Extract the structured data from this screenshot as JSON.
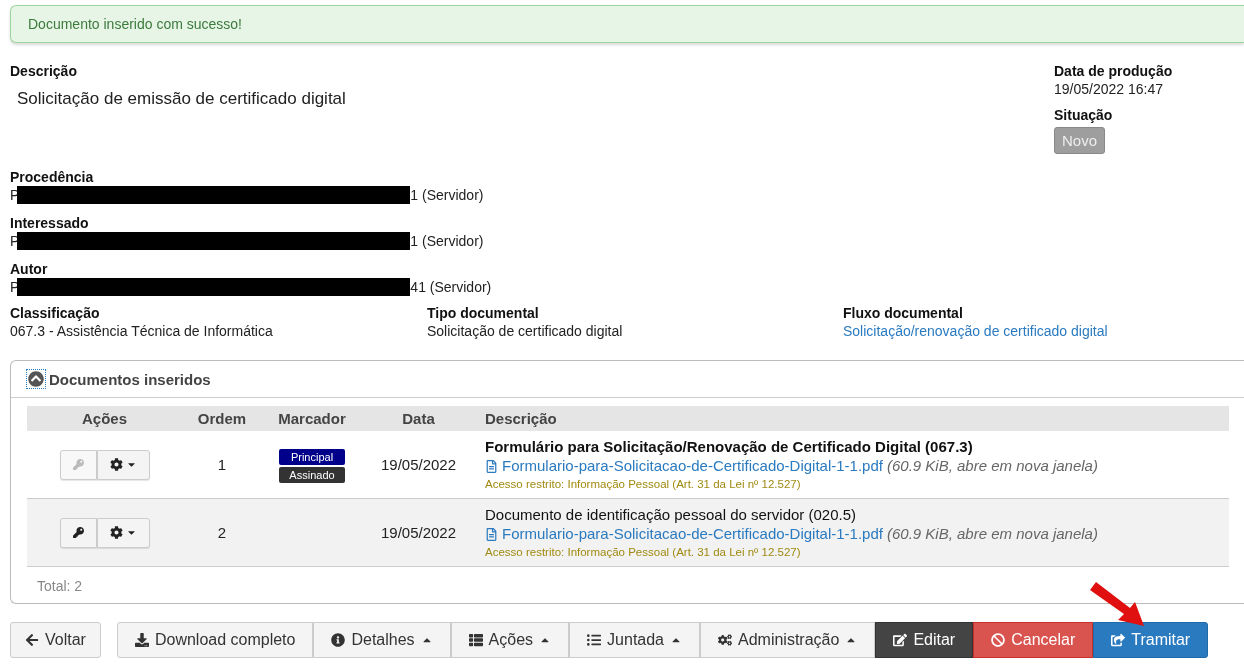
{
  "alert": {
    "message": "Documento inserido com sucesso!"
  },
  "description": {
    "label": "Descrição",
    "value": "Solicitação de emissão de certificado digital"
  },
  "production": {
    "label": "Data de produção",
    "value": "19/05/2022 16:47"
  },
  "status": {
    "label": "Situação",
    "badge": "Novo"
  },
  "people": [
    {
      "label": "Procedência",
      "prefix": "P",
      "suffix": "1 (Servidor)"
    },
    {
      "label": "Interessado",
      "prefix": "P",
      "suffix": "1 (Servidor)"
    },
    {
      "label": "Autor",
      "prefix": "P",
      "suffix": "41 (Servidor)"
    }
  ],
  "details": [
    {
      "label": "Classificação",
      "value": "067.3 - Assistência Técnica de Informática",
      "kind": "text"
    },
    {
      "label": "Tipo documental",
      "value": "Solicitação de certificado digital",
      "kind": "text"
    },
    {
      "label": "Fluxo documental",
      "value": "Solicitação/renovação de certificado digital",
      "kind": "link"
    }
  ],
  "panel": {
    "title": "Documentos inseridos",
    "columns": [
      "Ações",
      "Ordem",
      "Marcador",
      "Data",
      "Descrição"
    ],
    "rows": [
      {
        "key_disabled": true,
        "order": "1",
        "tags": [
          {
            "label": "Principal",
            "color": "#00008b"
          },
          {
            "label": "Assinado",
            "color": "#333333"
          }
        ],
        "date": "19/05/2022",
        "title": "Formulário para Solicitação/Renovação de Certificado Digital (067.3)",
        "title_bold": true,
        "file": "Formulario-para-Solicitacao-de-Certificado-Digital-1-1.pdf",
        "file_info": "(60.9 KiB, abre em nova janela)",
        "access": "Acesso restrito: Informação Pessoal",
        "access_law": "(Art. 31 da Lei nº 12.527)"
      },
      {
        "key_disabled": false,
        "order": "2",
        "date": "19/05/2022",
        "title": "Documento de identificação pessoal do servidor (020.5)",
        "title_bold": false,
        "file": "Formulario-para-Solicitacao-de-Certificado-Digital-1-1.pdf",
        "file_info": "(60.9 KiB, abre em nova janela)",
        "access": "Acesso restrito: Informação Pessoal",
        "access_law": "(Art. 31 da Lei nº 12.527)"
      }
    ],
    "total": "Total: 2"
  },
  "back_button": {
    "label": "Voltar"
  },
  "toolbar": [
    {
      "label": "Download completo",
      "kind": "default",
      "caret": false
    },
    {
      "label": "Detalhes",
      "kind": "default",
      "caret": true
    },
    {
      "label": "Ações",
      "kind": "default",
      "caret": true
    },
    {
      "label": "Juntada",
      "kind": "default",
      "caret": true
    },
    {
      "label": "Administração",
      "kind": "default",
      "caret": true
    },
    {
      "label": "Editar",
      "kind": "dark",
      "caret": false
    },
    {
      "label": "Cancelar",
      "kind": "danger",
      "caret": false
    },
    {
      "label": "Tramitar",
      "kind": "primary",
      "caret": false
    }
  ]
}
